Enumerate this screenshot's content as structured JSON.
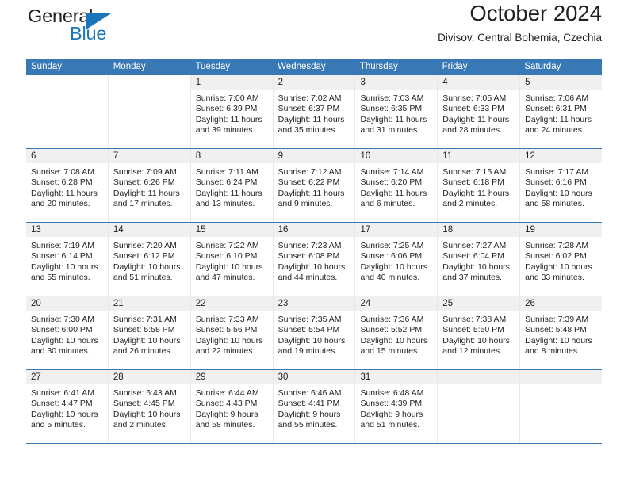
{
  "brand": {
    "name_part1": "General",
    "name_part2": "Blue"
  },
  "header": {
    "title": "October 2024",
    "subtitle": "Divisov, Central Bohemia, Czechia"
  },
  "colors": {
    "header_blue": "#3878b5",
    "brand_blue": "#1b75bb",
    "day_strip_gray": "#f0f0f0",
    "text": "#231f20"
  },
  "weekdays": [
    "Sunday",
    "Monday",
    "Tuesday",
    "Wednesday",
    "Thursday",
    "Friday",
    "Saturday"
  ],
  "weeks": [
    [
      {
        "day": "",
        "empty": true
      },
      {
        "day": "",
        "empty": true
      },
      {
        "day": "1",
        "sunrise": "Sunrise: 7:00 AM",
        "sunset": "Sunset: 6:39 PM",
        "daylight1": "Daylight: 11 hours",
        "daylight2": "and 39 minutes."
      },
      {
        "day": "2",
        "sunrise": "Sunrise: 7:02 AM",
        "sunset": "Sunset: 6:37 PM",
        "daylight1": "Daylight: 11 hours",
        "daylight2": "and 35 minutes."
      },
      {
        "day": "3",
        "sunrise": "Sunrise: 7:03 AM",
        "sunset": "Sunset: 6:35 PM",
        "daylight1": "Daylight: 11 hours",
        "daylight2": "and 31 minutes."
      },
      {
        "day": "4",
        "sunrise": "Sunrise: 7:05 AM",
        "sunset": "Sunset: 6:33 PM",
        "daylight1": "Daylight: 11 hours",
        "daylight2": "and 28 minutes."
      },
      {
        "day": "5",
        "sunrise": "Sunrise: 7:06 AM",
        "sunset": "Sunset: 6:31 PM",
        "daylight1": "Daylight: 11 hours",
        "daylight2": "and 24 minutes."
      }
    ],
    [
      {
        "day": "6",
        "sunrise": "Sunrise: 7:08 AM",
        "sunset": "Sunset: 6:28 PM",
        "daylight1": "Daylight: 11 hours",
        "daylight2": "and 20 minutes."
      },
      {
        "day": "7",
        "sunrise": "Sunrise: 7:09 AM",
        "sunset": "Sunset: 6:26 PM",
        "daylight1": "Daylight: 11 hours",
        "daylight2": "and 17 minutes."
      },
      {
        "day": "8",
        "sunrise": "Sunrise: 7:11 AM",
        "sunset": "Sunset: 6:24 PM",
        "daylight1": "Daylight: 11 hours",
        "daylight2": "and 13 minutes."
      },
      {
        "day": "9",
        "sunrise": "Sunrise: 7:12 AM",
        "sunset": "Sunset: 6:22 PM",
        "daylight1": "Daylight: 11 hours",
        "daylight2": "and 9 minutes."
      },
      {
        "day": "10",
        "sunrise": "Sunrise: 7:14 AM",
        "sunset": "Sunset: 6:20 PM",
        "daylight1": "Daylight: 11 hours",
        "daylight2": "and 6 minutes."
      },
      {
        "day": "11",
        "sunrise": "Sunrise: 7:15 AM",
        "sunset": "Sunset: 6:18 PM",
        "daylight1": "Daylight: 11 hours",
        "daylight2": "and 2 minutes."
      },
      {
        "day": "12",
        "sunrise": "Sunrise: 7:17 AM",
        "sunset": "Sunset: 6:16 PM",
        "daylight1": "Daylight: 10 hours",
        "daylight2": "and 58 minutes."
      }
    ],
    [
      {
        "day": "13",
        "sunrise": "Sunrise: 7:19 AM",
        "sunset": "Sunset: 6:14 PM",
        "daylight1": "Daylight: 10 hours",
        "daylight2": "and 55 minutes."
      },
      {
        "day": "14",
        "sunrise": "Sunrise: 7:20 AM",
        "sunset": "Sunset: 6:12 PM",
        "daylight1": "Daylight: 10 hours",
        "daylight2": "and 51 minutes."
      },
      {
        "day": "15",
        "sunrise": "Sunrise: 7:22 AM",
        "sunset": "Sunset: 6:10 PM",
        "daylight1": "Daylight: 10 hours",
        "daylight2": "and 47 minutes."
      },
      {
        "day": "16",
        "sunrise": "Sunrise: 7:23 AM",
        "sunset": "Sunset: 6:08 PM",
        "daylight1": "Daylight: 10 hours",
        "daylight2": "and 44 minutes."
      },
      {
        "day": "17",
        "sunrise": "Sunrise: 7:25 AM",
        "sunset": "Sunset: 6:06 PM",
        "daylight1": "Daylight: 10 hours",
        "daylight2": "and 40 minutes."
      },
      {
        "day": "18",
        "sunrise": "Sunrise: 7:27 AM",
        "sunset": "Sunset: 6:04 PM",
        "daylight1": "Daylight: 10 hours",
        "daylight2": "and 37 minutes."
      },
      {
        "day": "19",
        "sunrise": "Sunrise: 7:28 AM",
        "sunset": "Sunset: 6:02 PM",
        "daylight1": "Daylight: 10 hours",
        "daylight2": "and 33 minutes."
      }
    ],
    [
      {
        "day": "20",
        "sunrise": "Sunrise: 7:30 AM",
        "sunset": "Sunset: 6:00 PM",
        "daylight1": "Daylight: 10 hours",
        "daylight2": "and 30 minutes."
      },
      {
        "day": "21",
        "sunrise": "Sunrise: 7:31 AM",
        "sunset": "Sunset: 5:58 PM",
        "daylight1": "Daylight: 10 hours",
        "daylight2": "and 26 minutes."
      },
      {
        "day": "22",
        "sunrise": "Sunrise: 7:33 AM",
        "sunset": "Sunset: 5:56 PM",
        "daylight1": "Daylight: 10 hours",
        "daylight2": "and 22 minutes."
      },
      {
        "day": "23",
        "sunrise": "Sunrise: 7:35 AM",
        "sunset": "Sunset: 5:54 PM",
        "daylight1": "Daylight: 10 hours",
        "daylight2": "and 19 minutes."
      },
      {
        "day": "24",
        "sunrise": "Sunrise: 7:36 AM",
        "sunset": "Sunset: 5:52 PM",
        "daylight1": "Daylight: 10 hours",
        "daylight2": "and 15 minutes."
      },
      {
        "day": "25",
        "sunrise": "Sunrise: 7:38 AM",
        "sunset": "Sunset: 5:50 PM",
        "daylight1": "Daylight: 10 hours",
        "daylight2": "and 12 minutes."
      },
      {
        "day": "26",
        "sunrise": "Sunrise: 7:39 AM",
        "sunset": "Sunset: 5:48 PM",
        "daylight1": "Daylight: 10 hours",
        "daylight2": "and 8 minutes."
      }
    ],
    [
      {
        "day": "27",
        "sunrise": "Sunrise: 6:41 AM",
        "sunset": "Sunset: 4:47 PM",
        "daylight1": "Daylight: 10 hours",
        "daylight2": "and 5 minutes."
      },
      {
        "day": "28",
        "sunrise": "Sunrise: 6:43 AM",
        "sunset": "Sunset: 4:45 PM",
        "daylight1": "Daylight: 10 hours",
        "daylight2": "and 2 minutes."
      },
      {
        "day": "29",
        "sunrise": "Sunrise: 6:44 AM",
        "sunset": "Sunset: 4:43 PM",
        "daylight1": "Daylight: 9 hours",
        "daylight2": "and 58 minutes."
      },
      {
        "day": "30",
        "sunrise": "Sunrise: 6:46 AM",
        "sunset": "Sunset: 4:41 PM",
        "daylight1": "Daylight: 9 hours",
        "daylight2": "and 55 minutes."
      },
      {
        "day": "31",
        "sunrise": "Sunrise: 6:48 AM",
        "sunset": "Sunset: 4:39 PM",
        "daylight1": "Daylight: 9 hours",
        "daylight2": "and 51 minutes."
      },
      {
        "day": "",
        "empty_shaded": true
      },
      {
        "day": "",
        "empty_shaded": true
      }
    ]
  ]
}
